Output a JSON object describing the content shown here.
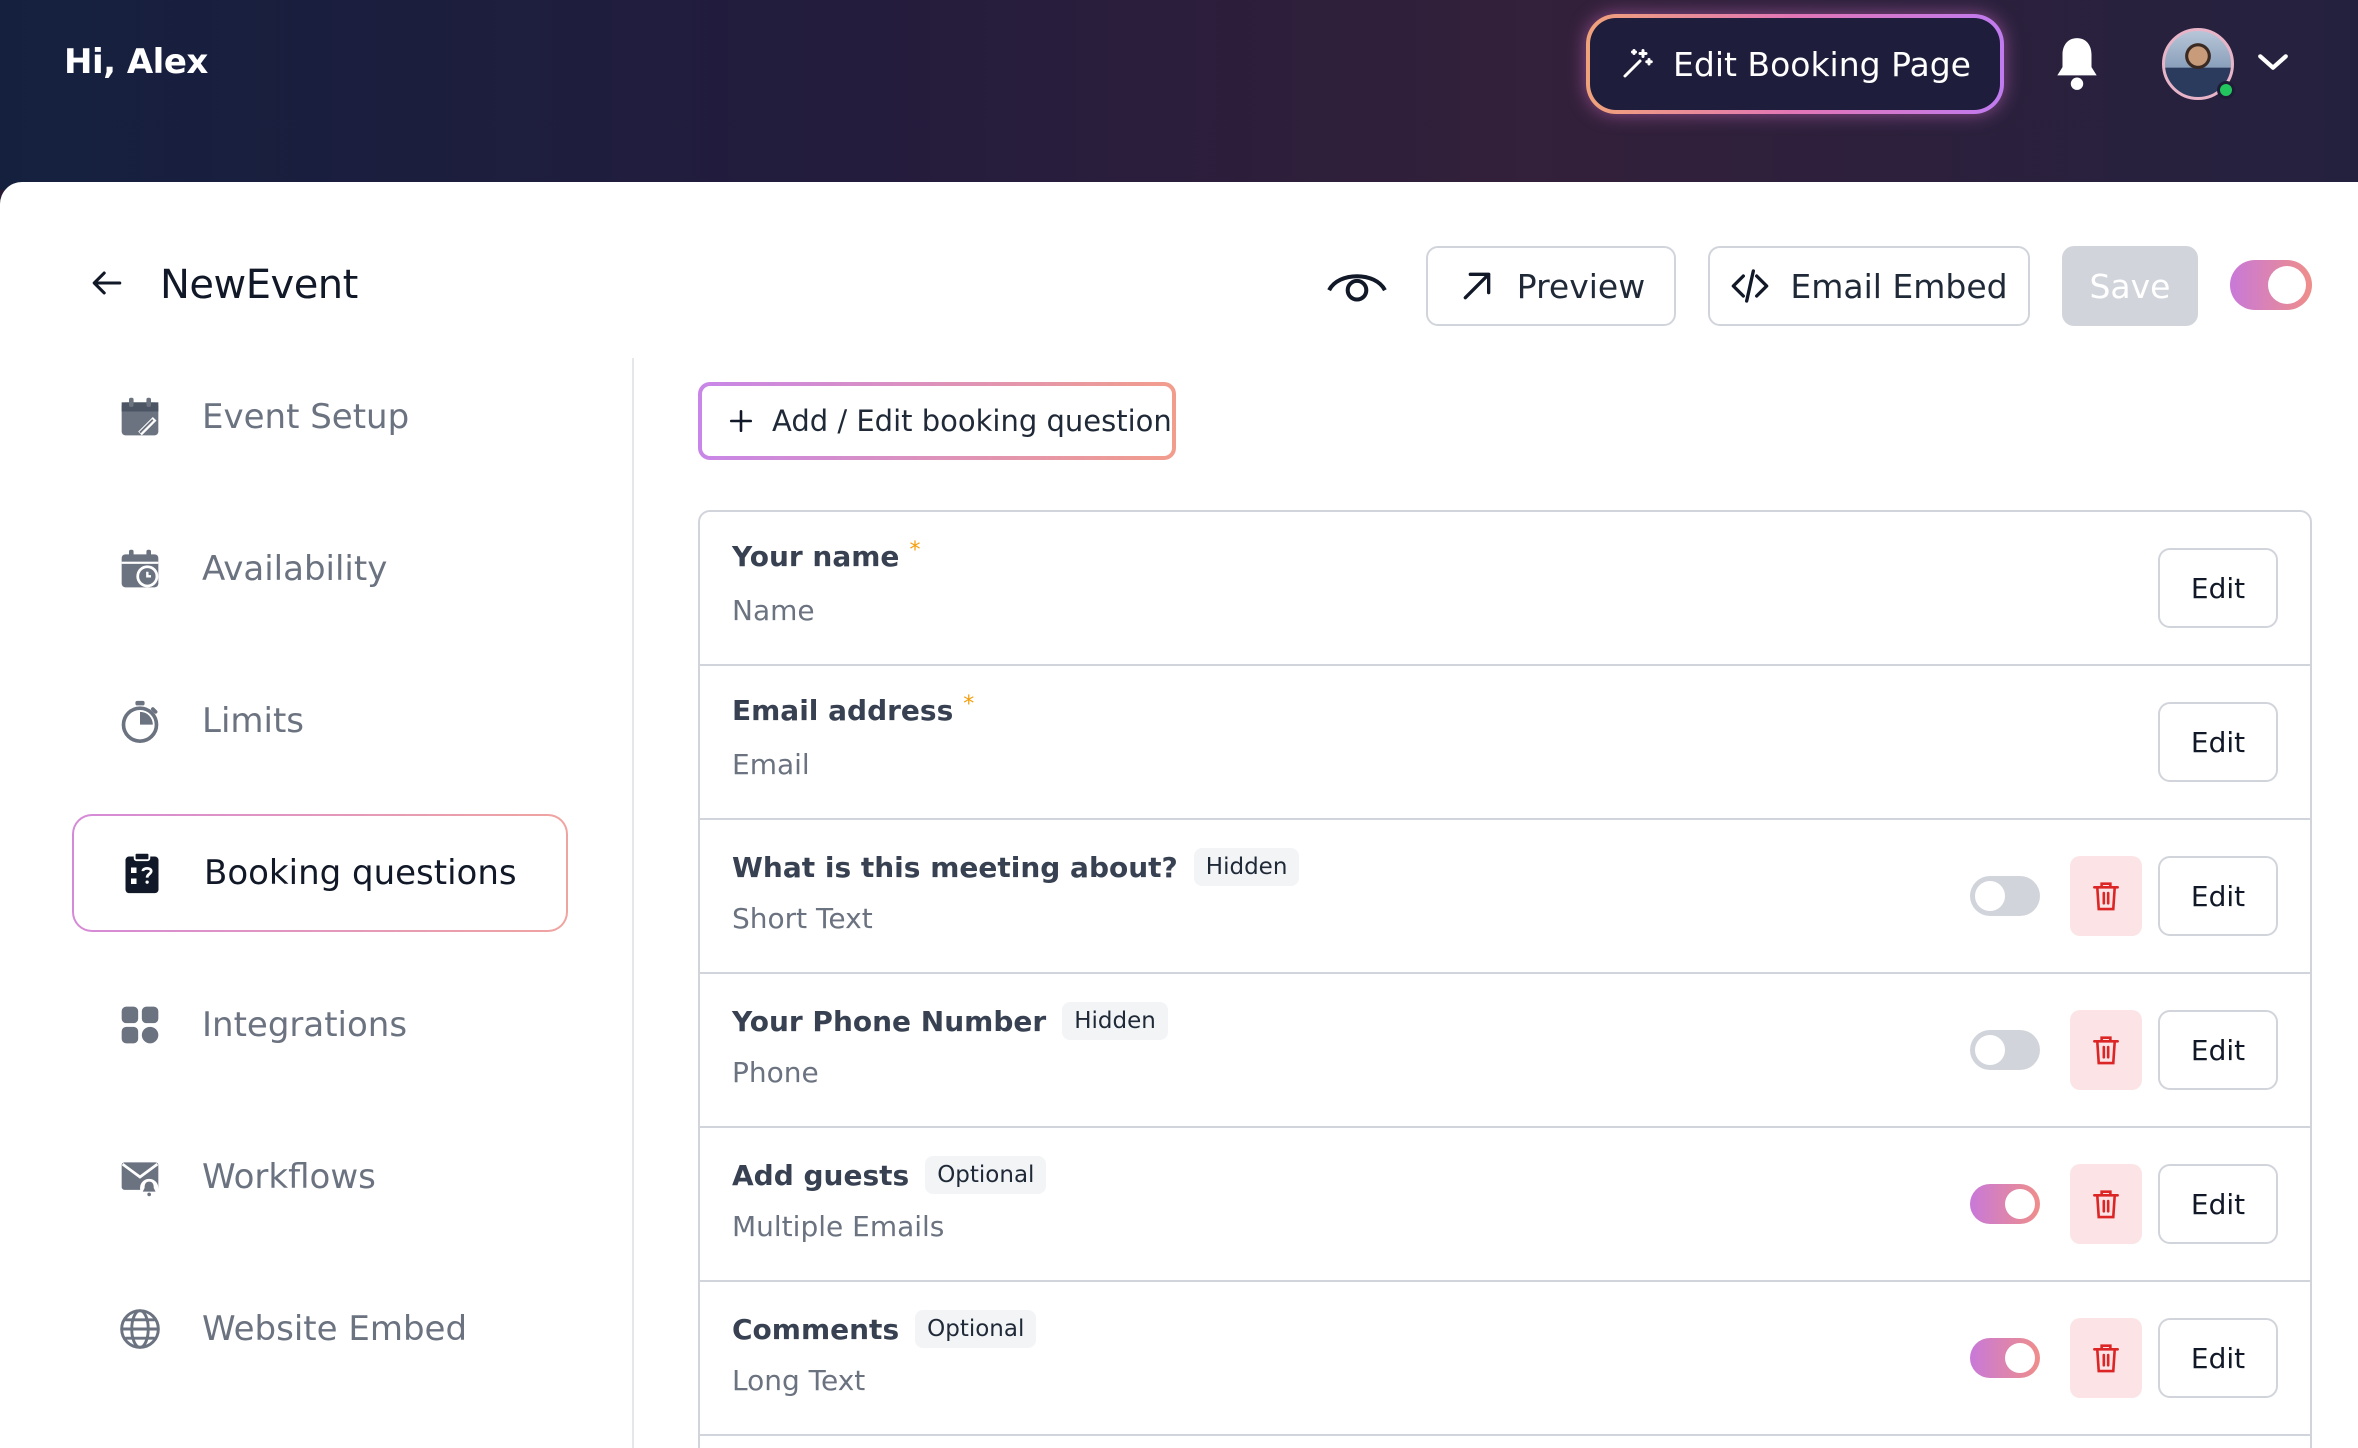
{
  "header": {
    "greeting": "Hi, Alex",
    "edit_booking_label": "Edit Booking Page",
    "icons": [
      "sparkle-wand-icon",
      "bell-icon",
      "avatar",
      "chevron-down-icon"
    ],
    "accent_gradient": [
      "#f0a27a",
      "#e275b6",
      "#c07bf0"
    ],
    "online_status_color": "#22c55e"
  },
  "toolbar": {
    "event_title": "NewEvent",
    "preview_label": "Preview",
    "email_embed_label": "Email Embed",
    "save_label": "Save",
    "event_enabled": true
  },
  "sidebar": {
    "items": [
      {
        "label": "Event Setup",
        "icon": "calendar-edit-icon",
        "active": false
      },
      {
        "label": "Availability",
        "icon": "calendar-clock-icon",
        "active": false
      },
      {
        "label": "Limits",
        "icon": "stopwatch-icon",
        "active": false
      },
      {
        "label": "Booking questions",
        "icon": "clipboard-question-icon",
        "active": true
      },
      {
        "label": "Integrations",
        "icon": "grid-icon",
        "active": false
      },
      {
        "label": "Workflows",
        "icon": "mail-workflow-icon",
        "active": false
      },
      {
        "label": "Website Embed",
        "icon": "globe-icon",
        "active": false
      }
    ]
  },
  "content": {
    "add_question_label": "Add / Edit booking question",
    "questions": [
      {
        "label": "Your name",
        "required_mark": "*",
        "badge": "",
        "type": "Name",
        "has_toggle": false,
        "toggle_on": false,
        "deletable": false,
        "edit_label": "Edit"
      },
      {
        "label": "Email address",
        "required_mark": "*",
        "badge": "",
        "type": "Email",
        "has_toggle": false,
        "toggle_on": false,
        "deletable": false,
        "edit_label": "Edit"
      },
      {
        "label": "What is this meeting about?",
        "required_mark": "",
        "badge": "Hidden",
        "type": "Short Text",
        "has_toggle": true,
        "toggle_on": false,
        "deletable": true,
        "edit_label": "Edit"
      },
      {
        "label": "Your Phone Number",
        "required_mark": "",
        "badge": "Hidden",
        "type": "Phone",
        "has_toggle": true,
        "toggle_on": false,
        "deletable": true,
        "edit_label": "Edit"
      },
      {
        "label": "Add guests",
        "required_mark": "",
        "badge": "Optional",
        "type": "Multiple Emails",
        "has_toggle": true,
        "toggle_on": true,
        "deletable": true,
        "edit_label": "Edit"
      },
      {
        "label": "Comments",
        "required_mark": "",
        "badge": "Optional",
        "type": "Long Text",
        "has_toggle": true,
        "toggle_on": true,
        "deletable": true,
        "edit_label": "Edit"
      }
    ]
  }
}
